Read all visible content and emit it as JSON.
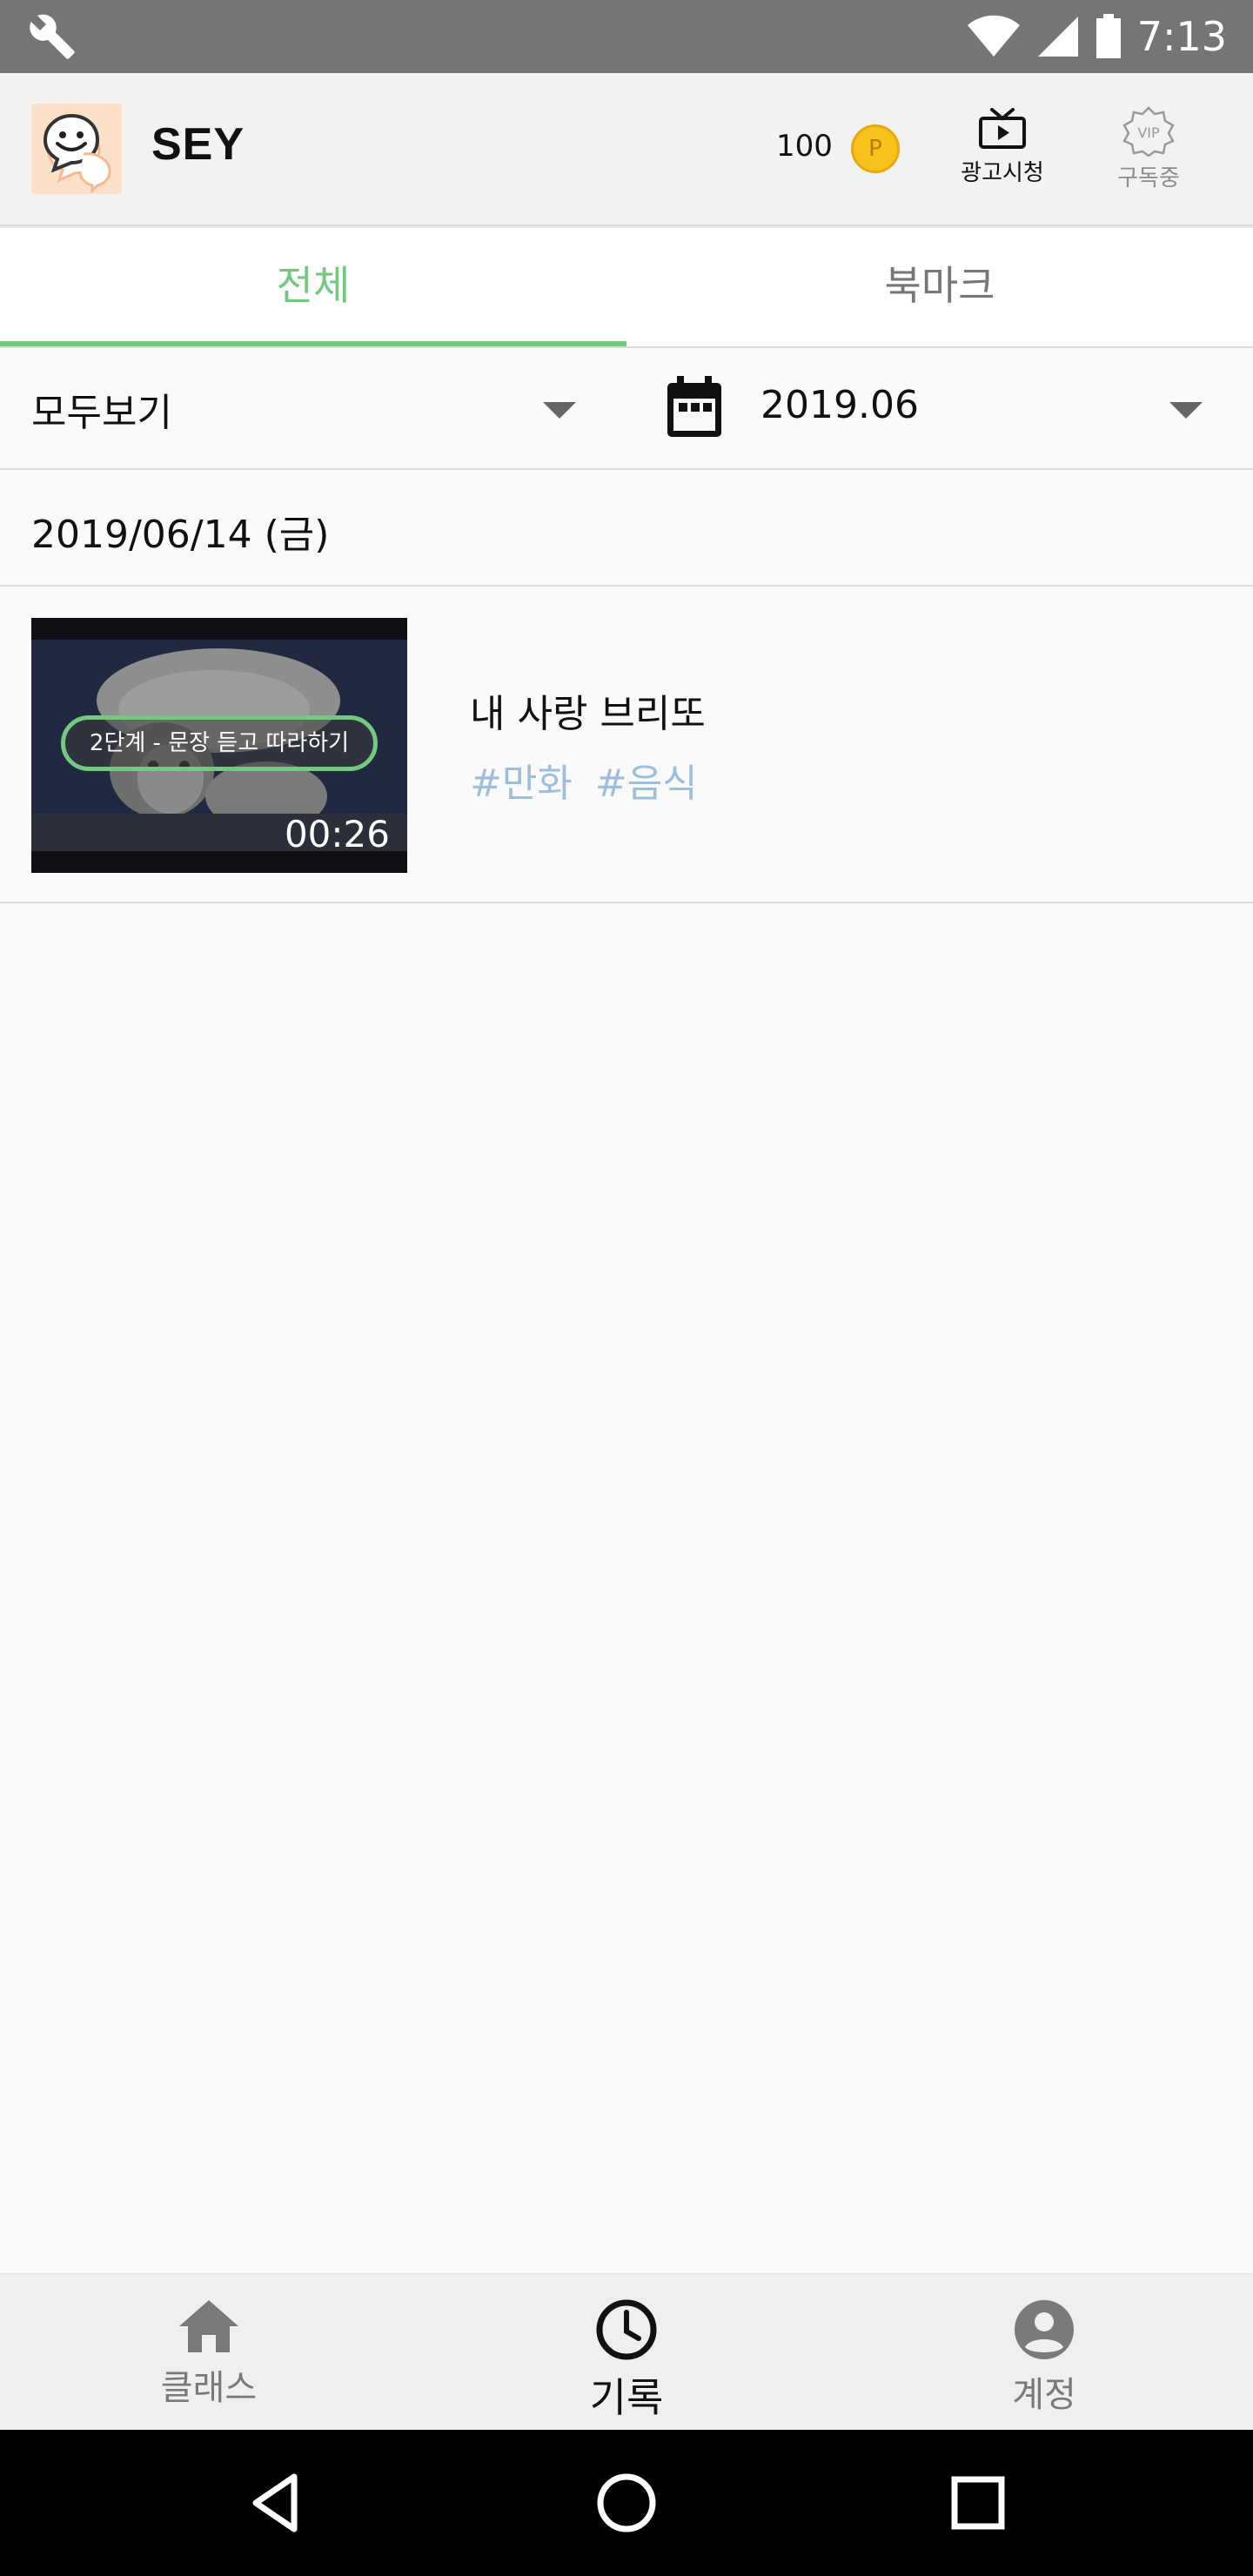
{
  "status_bar": {
    "time": "7:13"
  },
  "header": {
    "app_name": "SEY",
    "points": "100",
    "coin_symbol": "P",
    "ad_label": "광고시청",
    "vip_label": "구독중",
    "vip_badge_text": "VIP"
  },
  "tabs": [
    {
      "label": "전체",
      "active": true
    },
    {
      "label": "북마크",
      "active": false
    }
  ],
  "filters": {
    "category": "모두보기",
    "month": "2019.06"
  },
  "date_header": "2019/06/14 (금)",
  "items": [
    {
      "step_label": "2단계 - 문장 듣고 따라하기",
      "duration": "00:26",
      "title": "내 사랑 브리또",
      "tags": [
        "#만화",
        "#음식"
      ]
    }
  ],
  "bottom_nav": [
    {
      "label": "클래스",
      "icon": "home-icon",
      "active": false
    },
    {
      "label": "기록",
      "icon": "clock-icon",
      "active": true
    },
    {
      "label": "계정",
      "icon": "account-icon",
      "active": false
    }
  ],
  "colors": {
    "accent": "#72c97f",
    "tag": "#9dbfdd",
    "coin": "#f6c21b",
    "status_bar": "#757575"
  }
}
